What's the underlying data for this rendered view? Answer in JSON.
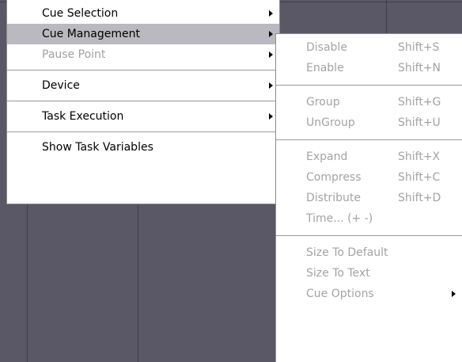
{
  "main_menu": {
    "items": [
      {
        "label": "Cue Selection",
        "arrow": true,
        "state": "normal"
      },
      {
        "label": "Cue Management",
        "arrow": true,
        "state": "selected"
      },
      {
        "label": "Pause Point",
        "arrow": true,
        "state": "disabled"
      },
      {
        "label": "Device",
        "arrow": true,
        "state": "normal"
      },
      {
        "label": "Task Execution",
        "arrow": true,
        "state": "normal"
      },
      {
        "label": "Show Task Variables",
        "arrow": false,
        "state": "normal"
      }
    ]
  },
  "sub_menu": {
    "items": [
      {
        "label": "Disable",
        "shortcut": "Shift+S"
      },
      {
        "label": "Enable",
        "shortcut": "Shift+N"
      },
      {
        "label": "Group",
        "shortcut": "Shift+G"
      },
      {
        "label": "UnGroup",
        "shortcut": "Shift+U"
      },
      {
        "label": "Expand",
        "shortcut": "Shift+X"
      },
      {
        "label": "Compress",
        "shortcut": "Shift+C"
      },
      {
        "label": "Distribute",
        "shortcut": "Shift+D"
      },
      {
        "label": "Time... (+ -)",
        "shortcut": ""
      },
      {
        "label": "Size To Default",
        "shortcut": ""
      },
      {
        "label": "Size To Text",
        "shortcut": ""
      },
      {
        "label": "Cue Options",
        "shortcut": "",
        "arrow": true
      }
    ]
  },
  "colors": {
    "background": "#5a5866",
    "menu": "#ffffff",
    "selected": "#b9b9bf",
    "disabled_text": "#a3a3a3"
  }
}
